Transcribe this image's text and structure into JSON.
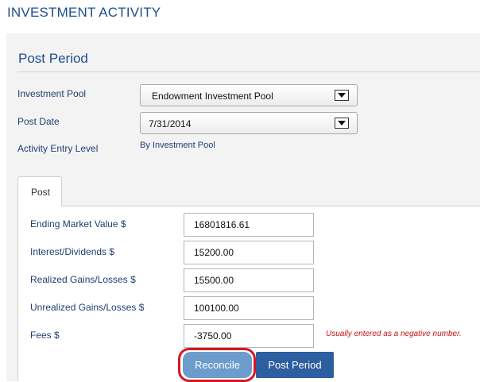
{
  "header": {
    "title": "INVESTMENT ACTIVITY"
  },
  "section": {
    "title": "Post Period"
  },
  "form": {
    "investment_pool": {
      "label": "Investment Pool",
      "value": "Endowment Investment Pool"
    },
    "post_date": {
      "label": "Post Date",
      "value": "7/31/2014"
    },
    "activity_entry_level": {
      "label": "Activity Entry Level",
      "value": "By Investment Pool"
    }
  },
  "tabs": [
    {
      "label": "Post",
      "active": true
    }
  ],
  "post": {
    "ending_market_value": {
      "label": "Ending Market Value $",
      "value": "16801816.61"
    },
    "interest_dividends": {
      "label": "Interest/Dividends $",
      "value": "15200.00"
    },
    "realized_gains_losses": {
      "label": "Realized Gains/Losses $",
      "value": "15500.00"
    },
    "unrealized_gains_losses": {
      "label": "Unrealized Gains/Losses $",
      "value": "100100.00"
    },
    "fees": {
      "label": "Fees $",
      "value": "-3750.00",
      "hint": "Usually entered as a negative number."
    }
  },
  "buttons": {
    "reconcile": "Reconcile",
    "post_period": "Post Period"
  },
  "colors": {
    "title_blue": "#1d4f8f",
    "label_blue": "#1f3f73",
    "hint_red": "#cc1111",
    "highlight_red": "#d41820",
    "reconcile_button": "#6c9ccc",
    "post_period_button": "#2c5ea0"
  }
}
